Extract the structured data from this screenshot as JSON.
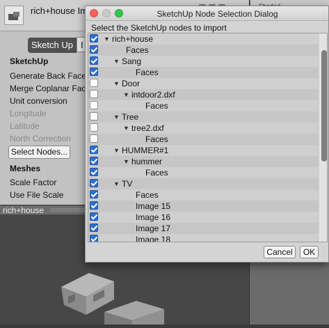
{
  "inspector": {
    "asset_title": "rich+house Im",
    "tabs": [
      "Sketch Up",
      "I"
    ],
    "section_sketchup": "SketchUp",
    "fields": [
      {
        "label": "Generate Back Face",
        "enabled": true
      },
      {
        "label": "Merge Coplanar Face",
        "enabled": true
      },
      {
        "label": "Unit conversion",
        "enabled": true
      },
      {
        "label": "Longitude",
        "enabled": false
      },
      {
        "label": "Latitude",
        "enabled": false
      },
      {
        "label": "North Correction",
        "enabled": false
      }
    ],
    "select_nodes_label": "Select Nodes...",
    "section_meshes": "Meshes",
    "mesh_fields": [
      "Scale Factor",
      "Use File Scale"
    ]
  },
  "right_panel": {
    "title": "Shaded"
  },
  "scene": {
    "title": "rich+house"
  },
  "dialog": {
    "title": "SketchUp Node Selection Dialog",
    "instruction": "Select the SketchUp nodes to import",
    "nodes": [
      {
        "label": "rich+house",
        "checked": true,
        "depth": 0,
        "expander": true
      },
      {
        "label": "Faces",
        "checked": true,
        "depth": 1,
        "expander": false
      },
      {
        "label": "Sang",
        "checked": true,
        "depth": 1,
        "expander": true
      },
      {
        "label": "Faces",
        "checked": true,
        "depth": 2,
        "expander": false
      },
      {
        "label": "Door",
        "checked": false,
        "depth": 1,
        "expander": true
      },
      {
        "label": "intdoor2.dxf",
        "checked": false,
        "depth": 2,
        "expander": true
      },
      {
        "label": "Faces",
        "checked": false,
        "depth": 3,
        "expander": false
      },
      {
        "label": "Tree",
        "checked": false,
        "depth": 1,
        "expander": true
      },
      {
        "label": "tree2.dxf",
        "checked": false,
        "depth": 2,
        "expander": true
      },
      {
        "label": "Faces",
        "checked": false,
        "depth": 3,
        "expander": false
      },
      {
        "label": "HUMMER#1",
        "checked": true,
        "depth": 1,
        "expander": true
      },
      {
        "label": "hummer",
        "checked": true,
        "depth": 2,
        "expander": true
      },
      {
        "label": "Faces",
        "checked": true,
        "depth": 3,
        "expander": false
      },
      {
        "label": "TV",
        "checked": true,
        "depth": 1,
        "expander": true
      },
      {
        "label": "Faces",
        "checked": true,
        "depth": 2,
        "expander": false
      },
      {
        "label": "Image 15",
        "checked": true,
        "depth": 2,
        "expander": false
      },
      {
        "label": "Image 16",
        "checked": true,
        "depth": 2,
        "expander": false
      },
      {
        "label": "Image 17",
        "checked": true,
        "depth": 2,
        "expander": false
      },
      {
        "label": "Image 18",
        "checked": true,
        "depth": 2,
        "expander": false
      }
    ],
    "cancel_label": "Cancel",
    "ok_label": "OK"
  },
  "colors": {
    "checkbox_on": "#2f6fd0",
    "close": "#fc605c",
    "maximize": "#34c84a"
  }
}
